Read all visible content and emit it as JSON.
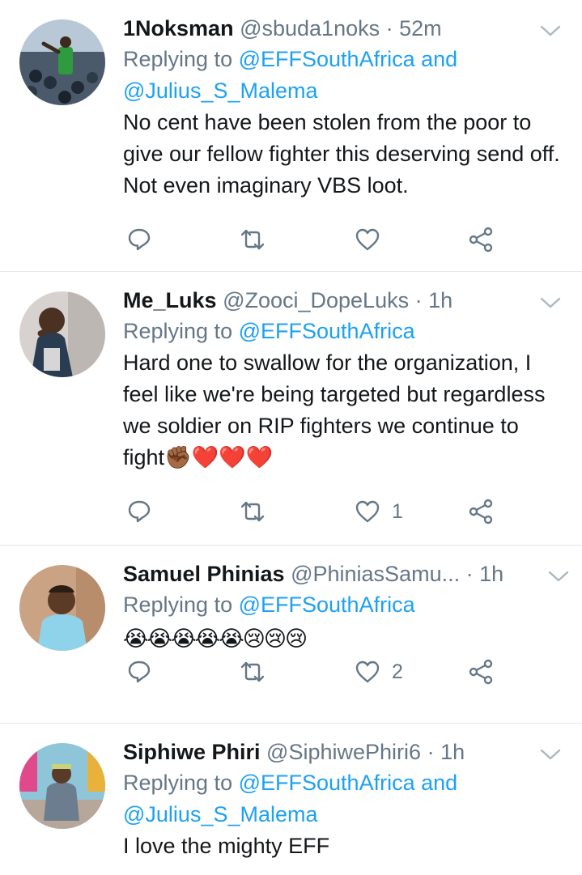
{
  "tweets": [
    {
      "name": "1Noksman",
      "handle": "@sbuda1noks",
      "dot": "·",
      "time": "52m",
      "reply_prefix": "Replying to",
      "mention1": "@EFFSouthAfrica",
      "and": "and",
      "mention2": "@Julius_S_Malema",
      "text": "No cent have been stolen from the poor to give our fellow fighter this deserving send off. Not even imaginary VBS loot.",
      "like_count": ""
    },
    {
      "name": "Me_Luks",
      "handle": "@Zooci_DopeLuks",
      "dot": "·",
      "time": "1h",
      "reply_prefix": "Replying to",
      "mention1": "@EFFSouthAfrica",
      "text": "Hard one to swallow for the organization, I feel like we're being targeted but regardless we soldier on RIP fighters we continue to fight✊🏾❤️❤️❤️",
      "like_count": "1"
    },
    {
      "name": "Samuel Phinias",
      "handle": "@PhiniasSamu...",
      "dot": "·",
      "time": "1h",
      "reply_prefix": "Replying to",
      "mention1": "@EFFSouthAfrica",
      "text": "😭😭😭😭😭😢😢😢",
      "like_count": "2"
    },
    {
      "name": "Siphiwe Phiri",
      "handle": "@SiphiwePhiri6",
      "dot": "·",
      "time": "1h",
      "reply_prefix": "Replying to",
      "mention1": "@EFFSouthAfrica",
      "and": "and",
      "mention2": "@Julius_S_Malema",
      "text": "I love the mighty EFF",
      "like_count": ""
    }
  ],
  "icons": {
    "reply": "reply-icon",
    "retweet": "retweet-icon",
    "like": "heart-icon",
    "share": "share-icon",
    "menu": "chevron-down-icon"
  },
  "colors": {
    "link": "#1da1f2",
    "secondary": "#657786",
    "text": "#14171a",
    "divider": "#e1e8ed"
  }
}
